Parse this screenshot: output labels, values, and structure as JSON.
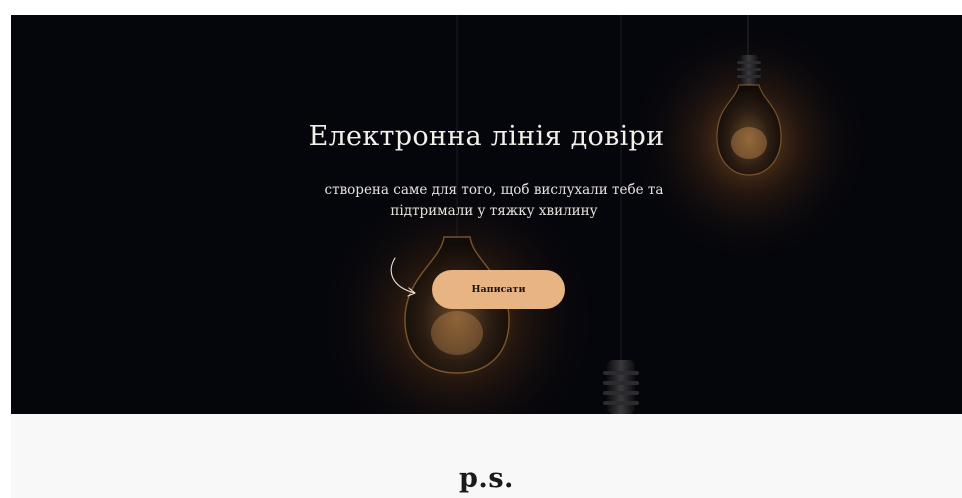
{
  "hero": {
    "title": "Електронна лінія довіри",
    "subtitle": "створена саме для того, щоб вислухали тебе та підтримали у тяжку хвилину",
    "button_label": "Написати"
  },
  "ps_section": {
    "heading": "p.s."
  },
  "colors": {
    "hero_background": "#05060c",
    "button": "#e9b483",
    "bulb_glow": "#d7883a",
    "lower_background": "#f8f8f8"
  },
  "icons": {
    "arrow": "curved-arrow-icon",
    "bulb": "light-bulb"
  }
}
